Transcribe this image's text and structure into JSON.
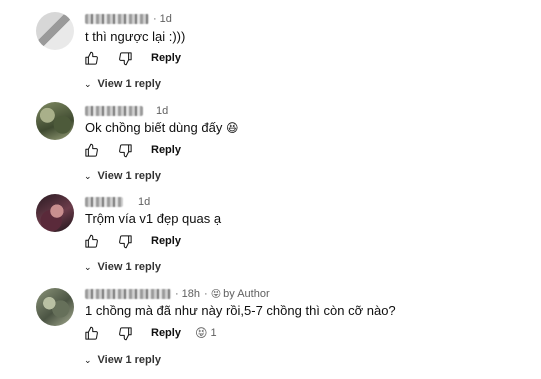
{
  "comments": [
    {
      "time": "1d",
      "author_badge": "",
      "text": "t thì ngược lại :)))",
      "emoji": "",
      "reply_label": "Reply",
      "reaction": "",
      "view_replies": "View 1 reply",
      "avatar_icon": "avatar-icon"
    },
    {
      "time": "1d",
      "author_badge": "",
      "text": "Ok chồng biết dùng đấy",
      "emoji": "😆",
      "reply_label": "Reply",
      "reaction": "",
      "view_replies": "View 1 reply",
      "avatar_icon": "avatar-icon"
    },
    {
      "time": "1d",
      "author_badge": "",
      "text": "Trộm vía v1 đẹp quas ạ",
      "emoji": "",
      "reply_label": "Reply",
      "reaction": "",
      "view_replies": "View 1 reply",
      "avatar_icon": "avatar-icon"
    },
    {
      "time": "18h",
      "author_badge_emoji": "😝",
      "author_badge": "by Author",
      "text": "1 chồng mà đã như này rồi,5-7 chồng thì còn cỡ nào?",
      "emoji": "",
      "reply_label": "Reply",
      "reaction_emoji": "😝",
      "reaction_count": "1",
      "view_replies": "View 1 reply",
      "avatar_icon": "avatar-icon"
    }
  ],
  "icons": {
    "like": "thumbs-up-icon",
    "dislike": "thumbs-down-icon",
    "chevron": "chevron-down-icon",
    "chevron_glyph": "⌄"
  },
  "separator": "·"
}
